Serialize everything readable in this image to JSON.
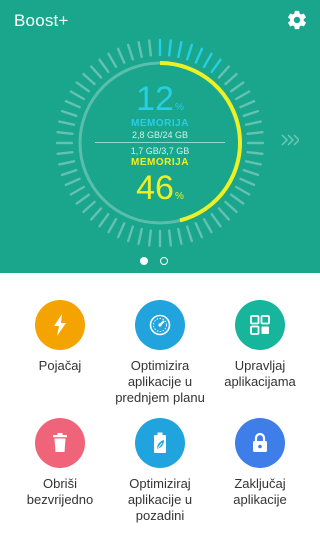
{
  "app": {
    "title": "Boost+"
  },
  "colors": {
    "hero": "#1aa58d",
    "cyan": "#27cfe4",
    "yellow": "#ecf024"
  },
  "gauge": {
    "top": {
      "percent": "12",
      "symbol": "%",
      "label": "MEMORIJA",
      "value": "2,8 GB/24 GB"
    },
    "bottom": {
      "percent": "46",
      "symbol": "%",
      "label": "MEMORIJA",
      "value": "1,7 GB/3,7 GB"
    },
    "outer_fraction": 0.12,
    "inner_fraction": 0.46
  },
  "pager": {
    "active_page": 1,
    "page_count": 2
  },
  "actions": [
    {
      "label_lines": [
        "Pojačaj"
      ],
      "color": "#f4a300",
      "icon": "lightning-icon"
    },
    {
      "label_lines": [
        "Optimizira",
        "aplikacije u",
        "prednjem planu"
      ],
      "color": "#21a4dd",
      "icon": "speedometer-icon"
    },
    {
      "label_lines": [
        "Upravljaj",
        "aplikacijama"
      ],
      "color": "#16b59c",
      "icon": "app-grid-icon"
    },
    {
      "label_lines": [
        "Obriši",
        "bezvrijedno"
      ],
      "color": "#ef6478",
      "icon": "trash-icon"
    },
    {
      "label_lines": [
        "Optimiziraj",
        "aplikacije u",
        "pozadini"
      ],
      "color": "#21a4dd",
      "icon": "battery-leaf-icon"
    },
    {
      "label_lines": [
        "Zaključaj",
        "aplikacije"
      ],
      "color": "#3f7ee8",
      "icon": "lock-icon"
    }
  ]
}
